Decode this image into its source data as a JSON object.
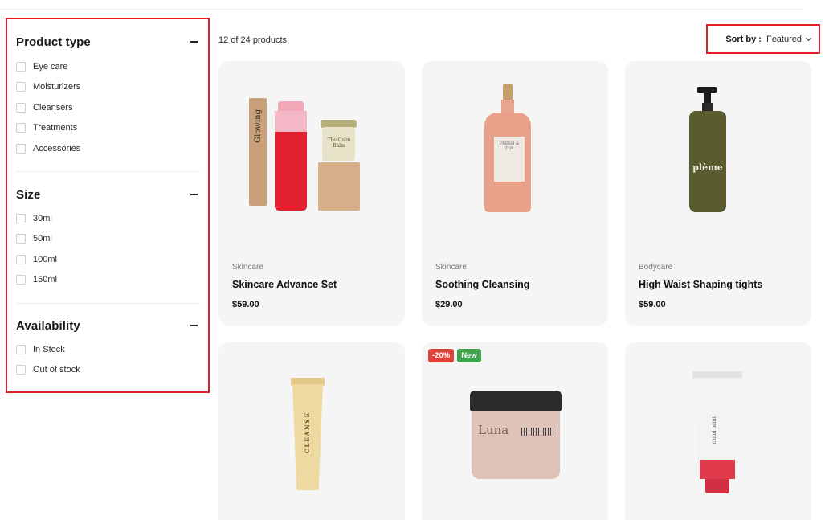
{
  "filters": {
    "product_type": {
      "title": "Product type",
      "options": [
        "Eye care",
        "Moisturizers",
        "Cleansers",
        "Treatments",
        "Accessories"
      ]
    },
    "size": {
      "title": "Size",
      "options": [
        "30ml",
        "50ml",
        "100ml",
        "150ml"
      ]
    },
    "availability": {
      "title": "Availability",
      "options": [
        "In Stock",
        "Out of stock"
      ]
    }
  },
  "toolbar": {
    "count": "12 of 24 products",
    "sort_label": "Sort by :",
    "sort_value": "Featured"
  },
  "products": [
    {
      "category": "Skincare",
      "name": "Skincare Advance Set",
      "price": "$59.00",
      "box_text": "Glowing",
      "jar_text": "The Calm Balm"
    },
    {
      "category": "Skincare",
      "name": "Soothing Cleansing",
      "price": "$29.00",
      "label_text": "FRESH & TOX"
    },
    {
      "category": "Bodycare",
      "name": "High Waist Shaping tights",
      "price": "$59.00",
      "label_text": "plème"
    },
    {
      "tube_text": "CLEANSE"
    },
    {
      "badges": [
        "-20%",
        "New"
      ],
      "brand_text": "Luna"
    },
    {
      "label_text": "cloud paint"
    }
  ],
  "colors": {
    "highlight": "#e01f26",
    "card_bg": "#f5f5f5",
    "badge_sale": "#e0433b",
    "badge_new": "#3fa34d"
  },
  "icons": [
    "minus-icon",
    "chevron-down-icon"
  ]
}
